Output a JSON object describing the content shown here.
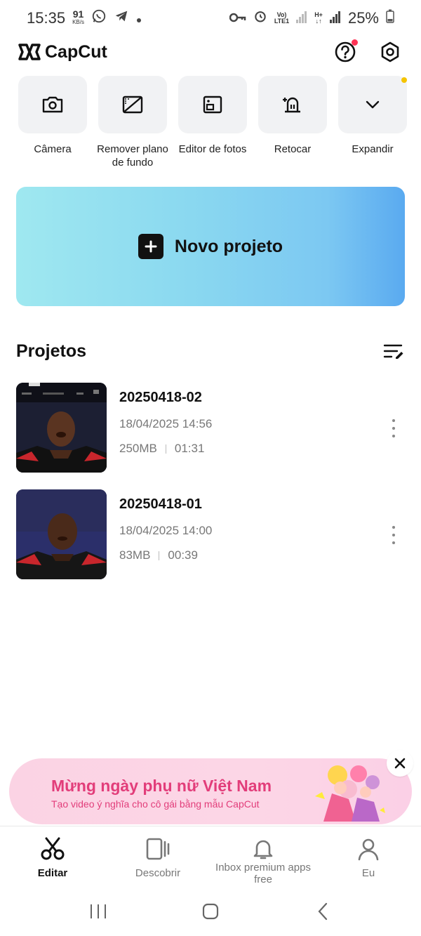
{
  "status_bar": {
    "time": "15:35",
    "speed_value": "91",
    "speed_unit": "KB/s",
    "network_top": "Vo)",
    "network_bottom": "LTE1",
    "network2_top": "H+",
    "battery": "25%"
  },
  "header": {
    "app_name": "CapCut"
  },
  "tools": [
    {
      "label": "Câmera",
      "icon": "camera-icon"
    },
    {
      "label": "Remover plano de fundo",
      "icon": "remove-background-icon"
    },
    {
      "label": "Editor de fotos",
      "icon": "photo-editor-icon"
    },
    {
      "label": "Retocar",
      "icon": "retouch-icon"
    },
    {
      "label": "Expandir",
      "icon": "chevron-down-icon"
    }
  ],
  "new_project": {
    "label": "Novo projeto"
  },
  "projects": {
    "title": "Projetos",
    "items": [
      {
        "name": "20250418-02",
        "date": "18/04/2025 14:56",
        "size": "250MB",
        "duration": "01:31"
      },
      {
        "name": "20250418-01",
        "date": "18/04/2025 14:00",
        "size": "83MB",
        "duration": "00:39"
      }
    ]
  },
  "banner": {
    "title": "Mừng ngày phụ nữ Việt Nam",
    "subtitle": "Tạo video ý nghĩa cho cô gái bằng mẫu CapCut"
  },
  "bottom_nav": [
    {
      "label": "Editar",
      "icon": "scissors-icon",
      "active": true
    },
    {
      "label": "Descobrir",
      "icon": "discover-icon",
      "active": false
    },
    {
      "label": "Inbox premium apps free",
      "icon": "bell-icon",
      "active": false
    },
    {
      "label": "Eu",
      "icon": "profile-icon",
      "active": false
    }
  ],
  "colors": {
    "banner_text": "#e23d7a",
    "notification_dot": "#ff3355",
    "expand_dot": "#f5c400"
  }
}
